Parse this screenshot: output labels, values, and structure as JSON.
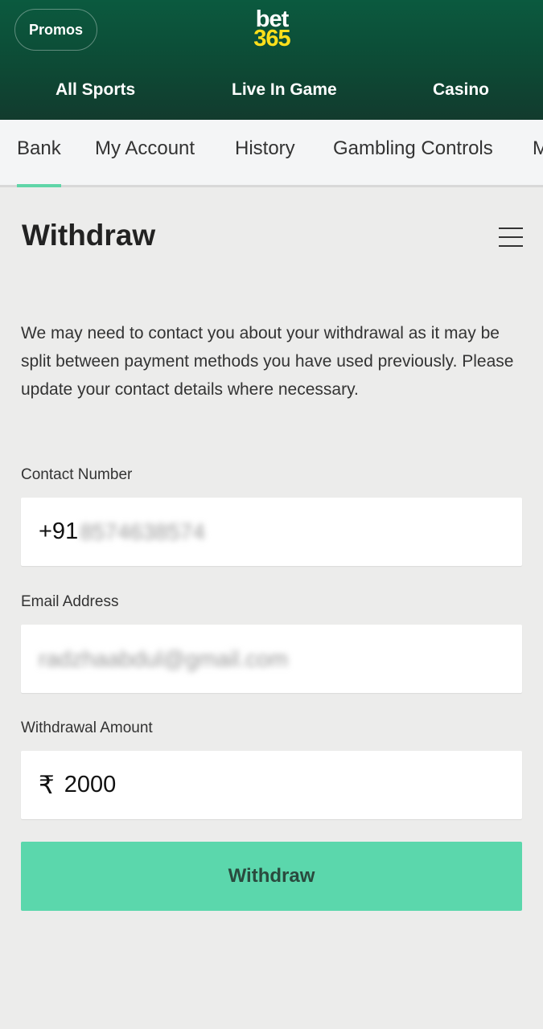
{
  "header": {
    "promos_label": "Promos",
    "logo_line1": "bet",
    "logo_line2": "365",
    "nav": [
      "All Sports",
      "Live In Game",
      "Casino"
    ]
  },
  "account_tabs": [
    "Bank",
    "My Account",
    "History",
    "Gambling Controls",
    "M"
  ],
  "active_tab": "Bank",
  "page": {
    "title": "Withdraw",
    "intro": "We may need to contact you about your withdrawal as it may be split between payment methods you have used previously. Please update your contact details where necessary."
  },
  "form": {
    "contact_label": "Contact Number",
    "contact_prefix": "+91",
    "contact_rest": "8574638574",
    "email_label": "Email Address",
    "email_value": "radzhaabdul@gmail.com",
    "amount_label": "Withdrawal Amount",
    "currency_symbol": "₹",
    "amount_value": "2000",
    "submit_label": "Withdraw"
  },
  "colors": {
    "header_green": "#0d4a35",
    "logo_yellow": "#ffdf1b",
    "accent_green": "#5bd7ac"
  }
}
